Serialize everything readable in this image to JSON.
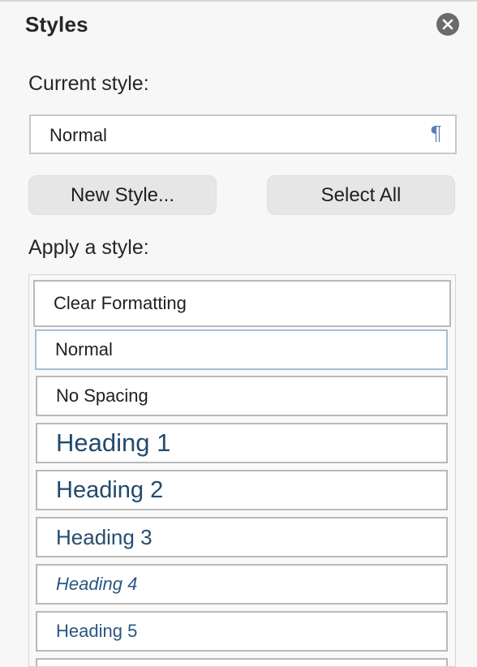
{
  "pane": {
    "title": "Styles",
    "close_icon": "close-icon"
  },
  "current_style": {
    "label": "Current style:",
    "value": "Normal",
    "indicator_glyph": "¶"
  },
  "buttons": {
    "new_style": "New Style...",
    "select_all": "Select All"
  },
  "apply_style": {
    "label": "Apply a style:",
    "items": [
      {
        "label": "Clear Formatting"
      },
      {
        "label": "Normal",
        "selected": true
      },
      {
        "label": "No Spacing"
      },
      {
        "label": "Heading 1"
      },
      {
        "label": "Heading 2"
      },
      {
        "label": "Heading 3"
      },
      {
        "label": "Heading 4"
      },
      {
        "label": "Heading 5"
      }
    ]
  },
  "colors": {
    "heading_text": "#244a6c",
    "selected_border": "#a5bfd8",
    "pilcrow": "#5b7fb5"
  }
}
